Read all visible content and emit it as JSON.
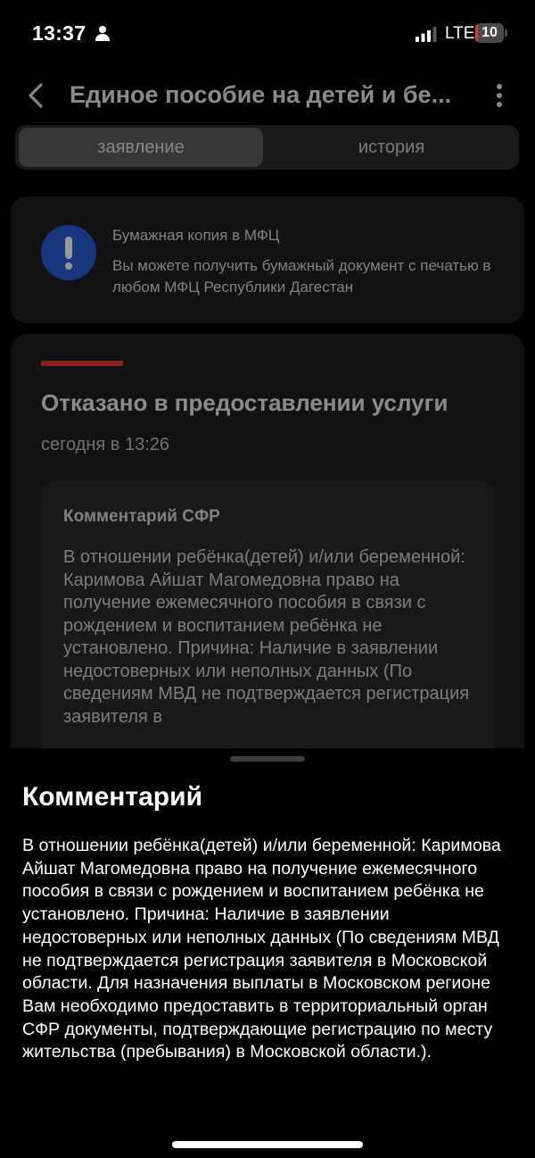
{
  "status_bar": {
    "time": "13:37",
    "network": "LTE",
    "battery_level": "10",
    "battery_color": "#e5362f"
  },
  "nav": {
    "title": "Единое пособие на детей и бе...",
    "back_icon": "chevron-left-icon",
    "more_icon": "more-vertical-icon"
  },
  "tabs": [
    {
      "label": "заявление",
      "active": true
    },
    {
      "label": "история",
      "active": false
    }
  ],
  "info_card": {
    "icon": "exclamation-icon",
    "title": "Бумажная копия в МФЦ",
    "text": "Вы можете получить бумажный документ с печатью в любом МФЦ Республики Дагестан"
  },
  "status_card": {
    "accent_color": "#e5362f",
    "heading": "Отказано в предоставлении услуги",
    "time": "сегодня в 13:26",
    "comment_title": "Комментарий СФР",
    "comment_text": "В отношении ребёнка(детей) и/или беременной: Каримова Айшат Магомедовна право на получение ежемесячного пособия в связи с рождением и воспитанием ребёнка не установлено. Причина: Наличие в заявлении недостоверных или неполных данных (По сведениям МВД не подтверждается регистрация заявителя в"
  },
  "sheet": {
    "title": "Комментарий",
    "text": "В отношении ребёнка(детей) и/или беременной: Каримова Айшат Магомедовна право на получение ежемесячного пособия в связи с рождением и воспитанием ребёнка не установлено. Причина: Наличие в заявлении недостоверных или неполных данных (По сведениям МВД не подтверждается регистрация заявителя в Московской области. Для назначения выплаты в Московском регионе Вам необходимо предоставить в территориальный орган СФР документы, подтверждающие регистрацию по месту жительства (пребывания) в Московской области.)."
  }
}
